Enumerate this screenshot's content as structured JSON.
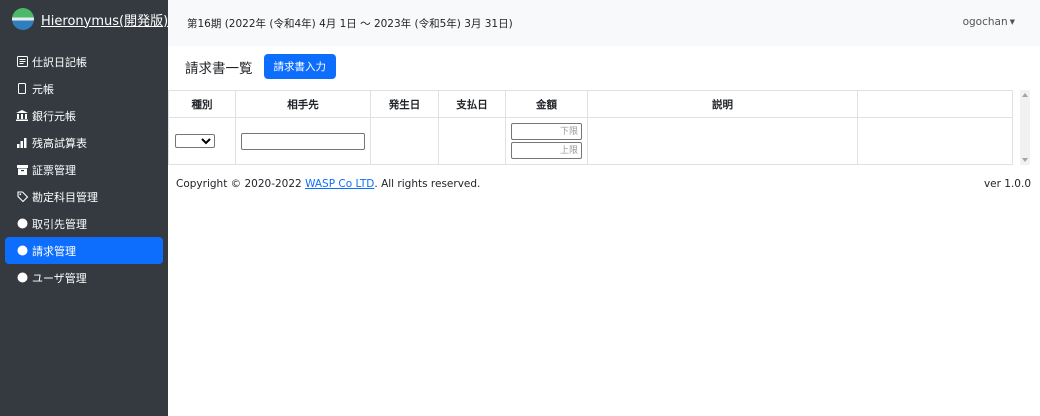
{
  "brand": {
    "name": "Hieronymus(開発版)"
  },
  "nav": [
    {
      "label": "仕訳日記帳",
      "icon": "journal-icon"
    },
    {
      "label": "元帳",
      "icon": "ledger-icon"
    },
    {
      "label": "銀行元帳",
      "icon": "bank-icon"
    },
    {
      "label": "残高試算表",
      "icon": "bar-chart-icon"
    },
    {
      "label": "証票管理",
      "icon": "archive-icon"
    },
    {
      "label": "勘定科目管理",
      "icon": "tag-icon"
    },
    {
      "label": "取引先管理",
      "icon": "circle-icon"
    },
    {
      "label": "請求管理",
      "icon": "circle-icon",
      "active": true
    },
    {
      "label": "ユーザ管理",
      "icon": "circle-icon"
    }
  ],
  "header": {
    "period": "第16期 (2022年 (令和4年) 4月 1日 〜 2023年 (令和5年) 3月 31日)",
    "user": "ogochan"
  },
  "page": {
    "title": "請求書一覧",
    "new_button": "請求書入力"
  },
  "table": {
    "headers": [
      "種別",
      "相手先",
      "発生日",
      "支払日",
      "金額",
      "説明",
      ""
    ],
    "filters": {
      "amount_lower_placeholder": "下限",
      "amount_upper_placeholder": "上限"
    }
  },
  "footer": {
    "copyright_prefix": "Copyright © 2020-2022 ",
    "company": "WASP Co LTD",
    "copyright_suffix": ". All rights reserved.",
    "version": "ver 1.0.0"
  },
  "colors": {
    "sidebar_bg": "#343a40",
    "accent": "#0d6efd",
    "topbar_bg": "#f8f9fa"
  }
}
